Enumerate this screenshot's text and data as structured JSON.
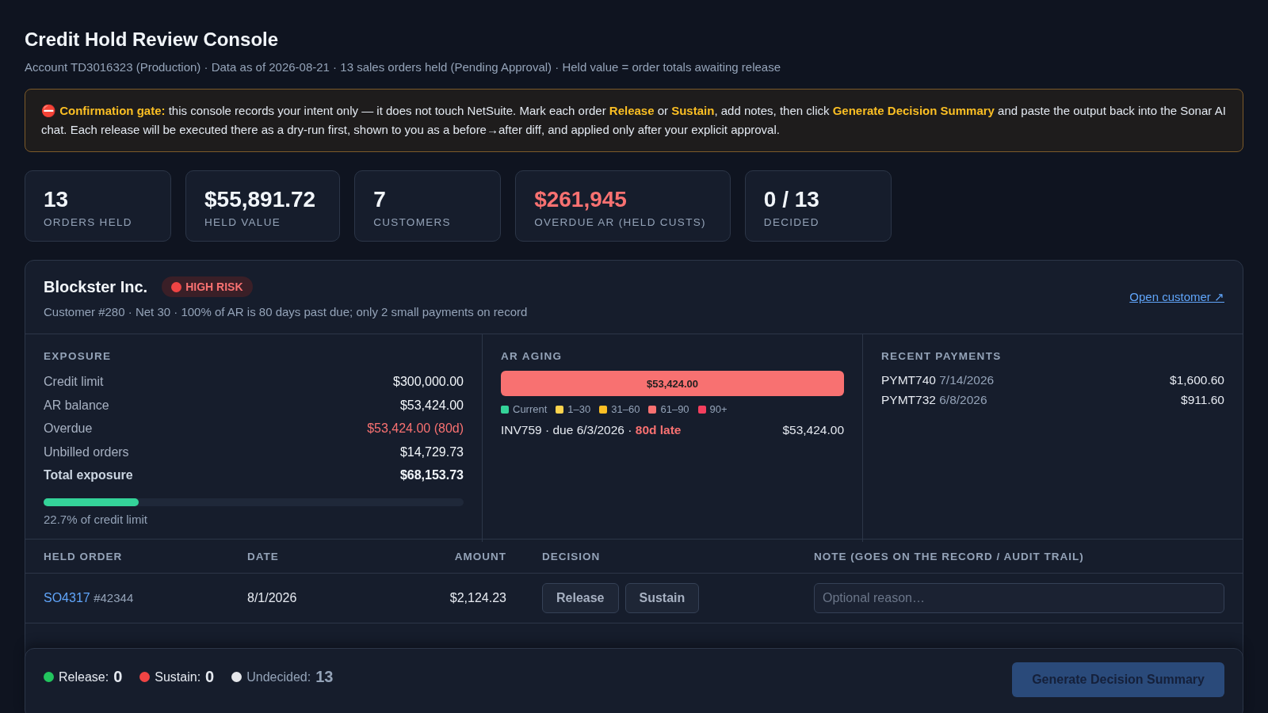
{
  "header": {
    "title": "Credit Hold Review Console",
    "subtitle": "Account TD3016323 (Production) · Data as of 2026-08-21 · 13 sales orders held (Pending Approval) · Held value = order totals awaiting release"
  },
  "notice": {
    "icon": "⛔",
    "text": "**Confirmation gate:** this console records your intent only — it does not touch NetSuite. Mark each order **Release** or **Sustain**, add notes, then click **Generate Decision Summary** and paste the output back into the Sonar AI chat. Each release will be executed there as a dry-run first, shown to you as a before→after diff, and applied only after your explicit approval."
  },
  "stats": [
    {
      "value": "13",
      "label": "ORDERS HELD",
      "kind": "normal"
    },
    {
      "value": "$55,891.72",
      "label": "HELD VALUE",
      "kind": "normal"
    },
    {
      "value": "7",
      "label": "CUSTOMERS",
      "kind": "normal"
    },
    {
      "value": "$261,945",
      "label": "OVERDUE AR (HELD CUSTS)",
      "kind": "alert"
    },
    {
      "value": "0 / 13",
      "label": "DECIDED",
      "kind": "normal"
    }
  ],
  "customer": {
    "name": "Blockster Inc.",
    "risk": {
      "label": "HIGH RISK",
      "color": "#ef4444"
    },
    "details": "Customer #280 · Net 30 · 100% of AR is 80 days past due; only 2 small payments on record",
    "link": "Open customer ↗",
    "exposure": {
      "heading": "EXPOSURE",
      "rows": [
        {
          "label": "Credit limit",
          "value": "$300,000.00",
          "kind": "normal"
        },
        {
          "label": "AR balance",
          "value": "$53,424.00",
          "kind": "normal"
        },
        {
          "label": "Overdue",
          "value": "$53,424.00 (80d)",
          "kind": "alert"
        },
        {
          "label": "Unbilled orders",
          "value": "$14,729.73",
          "kind": "normal"
        },
        {
          "label": "Total exposure",
          "value": "$68,153.73",
          "kind": "total"
        }
      ],
      "meter": {
        "level": 0.227,
        "caption": "22.7% of credit limit"
      }
    },
    "aging": {
      "heading": "AR AGING",
      "segments": [
        {
          "label": "$53,424.00",
          "level": 1,
          "color": "#f87171"
        }
      ],
      "legend": [
        {
          "label": "Current",
          "color": "#34d399"
        },
        {
          "label": "1–30",
          "color": "#fcd34d"
        },
        {
          "label": "31–60",
          "color": "#fbbf24"
        },
        {
          "label": "61–90",
          "color": "#f87171"
        },
        {
          "label": "90+",
          "color": "#f43f5e"
        }
      ],
      "invoices": [
        {
          "text": "INV759 · due 6/3/2026 · ",
          "late": "80d late",
          "amount": "$53,424.00"
        }
      ]
    },
    "payments": {
      "heading": "RECENT PAYMENTS",
      "items": [
        {
          "id": "PYMT740",
          "date": "7/14/2026",
          "amount": "$1,600.60"
        },
        {
          "id": "PYMT732",
          "date": "6/8/2026",
          "amount": "$911.60"
        }
      ]
    }
  },
  "orders": {
    "columns": [
      "HELD ORDER",
      "DATE",
      "AMOUNT",
      "DECISION",
      "NOTE (GOES ON THE RECORD / AUDIT TRAIL)"
    ],
    "rows": [
      {
        "order": "SO4317",
        "ref": "#42344",
        "date": "8/1/2026",
        "amount": "$2,124.23",
        "decisions": [
          {
            "label": "Release",
            "selected": false
          },
          {
            "label": "Sustain",
            "selected": false
          }
        ],
        "note_placeholder": "Optional reason…"
      }
    ]
  },
  "footer": {
    "tallies": [
      {
        "label": "Release:",
        "count": "0",
        "color": "#22c55e",
        "kind": "strong"
      },
      {
        "label": "Sustain:",
        "count": "0",
        "color": "#ef4444",
        "kind": "strong"
      },
      {
        "label": "Undecided:",
        "count": "13",
        "color": "#e5e7eb",
        "kind": "muted"
      }
    ],
    "button": {
      "label": "Generate Decision Summary",
      "disabled": true
    }
  }
}
